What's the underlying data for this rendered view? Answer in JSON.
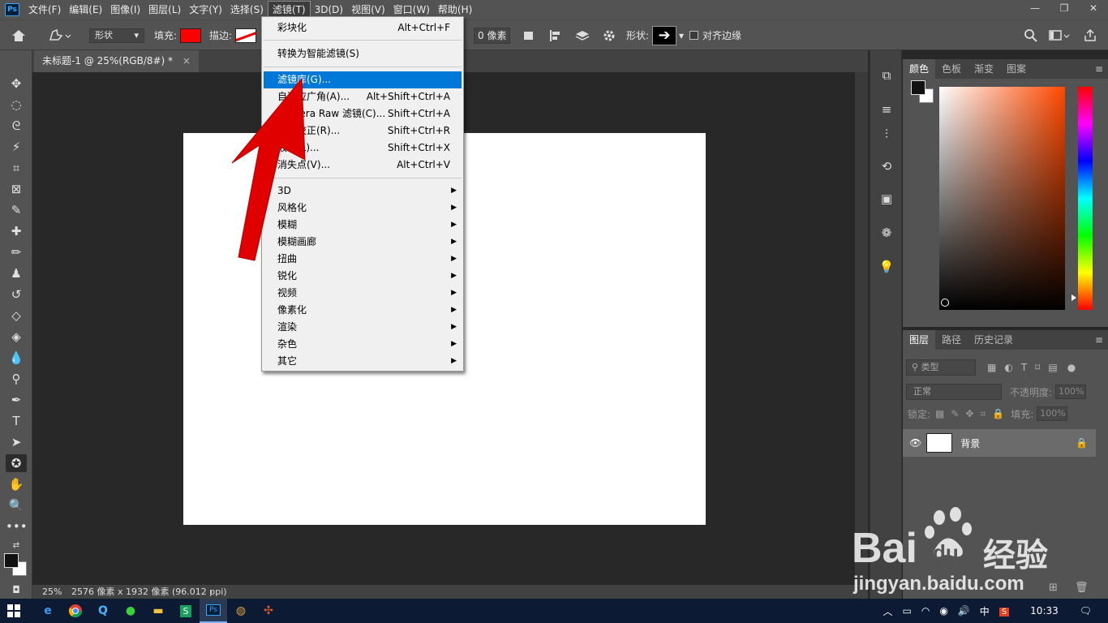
{
  "menubar": {
    "logo": "Ps",
    "items": [
      "文件(F)",
      "编辑(E)",
      "图像(I)",
      "图层(L)",
      "文字(Y)",
      "选择(S)",
      "滤镜(T)",
      "3D(D)",
      "视图(V)",
      "窗口(W)",
      "帮助(H)"
    ],
    "active_index": 6,
    "window_controls": [
      "—",
      "❐",
      "✕"
    ]
  },
  "options": {
    "mode": "形状",
    "fill_label": "填充:",
    "fill_color": "#ff0000",
    "stroke_label": "描边:",
    "stroke_width": "0 像素",
    "shape_label": "形状:",
    "align_edges": "对齐边缘"
  },
  "document": {
    "tab_title": "未标题-1 @ 25%(RGB/8#) *",
    "close": "×",
    "zoom": "25%",
    "info": "2576 像素 x 1932 像素 (96.012 ppi)"
  },
  "filter_menu": {
    "items": [
      {
        "label": "彩块化",
        "shortcut": "Alt+Ctrl+F"
      },
      {
        "label": "转换为智能滤镜(S)",
        "shortcut": ""
      },
      {
        "label": "滤镜库(G)...",
        "shortcut": "",
        "highlight": true
      },
      {
        "label": "自适应广角(A)...",
        "shortcut": "Alt+Shift+Ctrl+A"
      },
      {
        "label": "Camera Raw 滤镜(C)...",
        "shortcut": "Shift+Ctrl+A"
      },
      {
        "label": "镜头校正(R)...",
        "shortcut": "Shift+Ctrl+R"
      },
      {
        "label": "液化(L)...",
        "shortcut": "Shift+Ctrl+X"
      },
      {
        "label": "消失点(V)...",
        "shortcut": "Alt+Ctrl+V"
      }
    ],
    "submenus": [
      "3D",
      "风格化",
      "模糊",
      "模糊画廊",
      "扭曲",
      "锐化",
      "视频",
      "像素化",
      "渲染",
      "杂色",
      "其它"
    ]
  },
  "color_panel": {
    "tabs": [
      "颜色",
      "色板",
      "渐变",
      "图案"
    ],
    "fg": "#111111",
    "bg": "#ffffff"
  },
  "layers_panel": {
    "tabs": [
      "图层",
      "路径",
      "历史记录"
    ],
    "kind_placeholder": "类型",
    "blend_mode": "正常",
    "opacity_label": "不透明度:",
    "opacity_value": "100%",
    "lock_label": "锁定:",
    "fill_label": "填充:",
    "fill_value": "100%",
    "layer_name": "背景"
  },
  "watermark": {
    "brand": "Bai",
    "brand2": "du",
    "cn": "经验",
    "url": "jingyan.baidu.com"
  },
  "taskbar": {
    "ime": "中",
    "time": "10:33"
  }
}
